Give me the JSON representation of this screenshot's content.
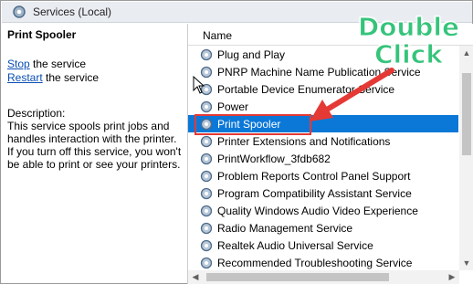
{
  "window": {
    "title": "Services (Local)"
  },
  "left_pane": {
    "service_name": "Print Spooler",
    "stop_link": "Stop",
    "stop_suffix": " the service",
    "restart_link": "Restart",
    "restart_suffix": " the service",
    "description_label": "Description:",
    "description_text": "This service spools print jobs and\nhandles interaction with the printer.\nIf you turn off this service, you won't\nbe able to print or see your printers."
  },
  "list": {
    "column_name": "Name",
    "services": [
      {
        "label": "Plug and Play"
      },
      {
        "label": "PNRP Machine Name Publication Service"
      },
      {
        "label": "Portable Device Enumerator Service"
      },
      {
        "label": "Power"
      },
      {
        "label": "Print Spooler",
        "selected": true
      },
      {
        "label": "Printer Extensions and Notifications"
      },
      {
        "label": "PrintWorkflow_3fdb682"
      },
      {
        "label": "Problem Reports Control Panel Support"
      },
      {
        "label": "Program Compatibility Assistant Service"
      },
      {
        "label": "Quality Windows Audio Video Experience"
      },
      {
        "label": "Radio Management Service"
      },
      {
        "label": "Realtek Audio Universal Service"
      },
      {
        "label": "Recommended Troubleshooting Service"
      }
    ]
  },
  "annotation": {
    "line1": "Double",
    "line2": "Click"
  },
  "colors": {
    "selection": "#0b78d7",
    "annotation_text": "#35c47a",
    "arrow": "#e53935"
  }
}
